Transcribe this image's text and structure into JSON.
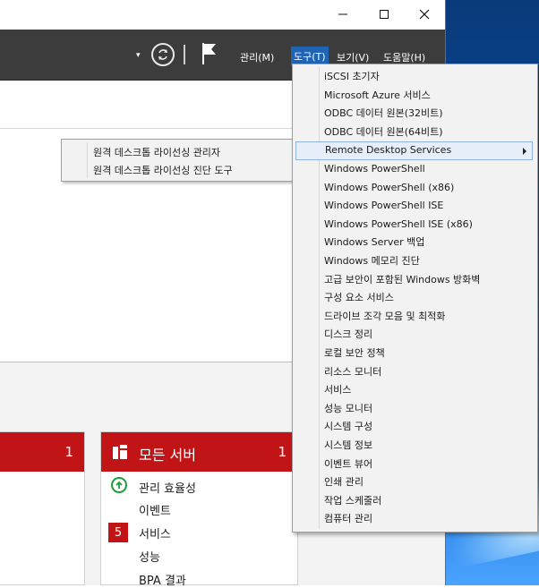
{
  "window": {
    "caption_min": "—",
    "caption_max": "☐",
    "caption_close": "✕"
  },
  "toolbar": {
    "menus": {
      "manage": "관리(M)",
      "tools": "도구(T)",
      "view": "보기(V)",
      "help": "도움말(H)"
    },
    "dropdown_caret": "▾"
  },
  "tools_menu": {
    "items": [
      "iSCSI 초기자",
      "Microsoft Azure 서비스",
      "ODBC 데이터 원본(32비트)",
      "ODBC 데이터 원본(64비트)",
      "Remote Desktop Services",
      "Windows PowerShell",
      "Windows PowerShell (x86)",
      "Windows PowerShell ISE",
      "Windows PowerShell ISE (x86)",
      "Windows Server 백업",
      "Windows 메모리 진단",
      "고급 보안이 포함된 Windows 방화벽",
      "구성 요소 서비스",
      "드라이브 조각 모음 및 최적화",
      "디스크 정리",
      "로컬 보안 정책",
      "리소스 모니터",
      "서비스",
      "성능 모니터",
      "시스템 구성",
      "시스템 정보",
      "이벤트 뷰어",
      "인쇄 관리",
      "작업 스케줄러",
      "컴퓨터 관리"
    ],
    "highlighted_index": 4
  },
  "rds_submenu": {
    "items": [
      "원격 데스크톱 라이선싱 관리자",
      "원격 데스크톱 라이선싱 진단 도구"
    ]
  },
  "tiles": {
    "left": {
      "count": "1"
    },
    "right": {
      "title": "모든 서버",
      "count": "1",
      "rows": [
        "관리 효율성",
        "이벤트",
        "서비스",
        "성능",
        "BPA 결과"
      ],
      "services_badge": "5"
    }
  },
  "colors": {
    "accent_red": "#c01417",
    "menu_highlight": "#1e63b4",
    "toolbar_bg": "#3c3c3c"
  }
}
